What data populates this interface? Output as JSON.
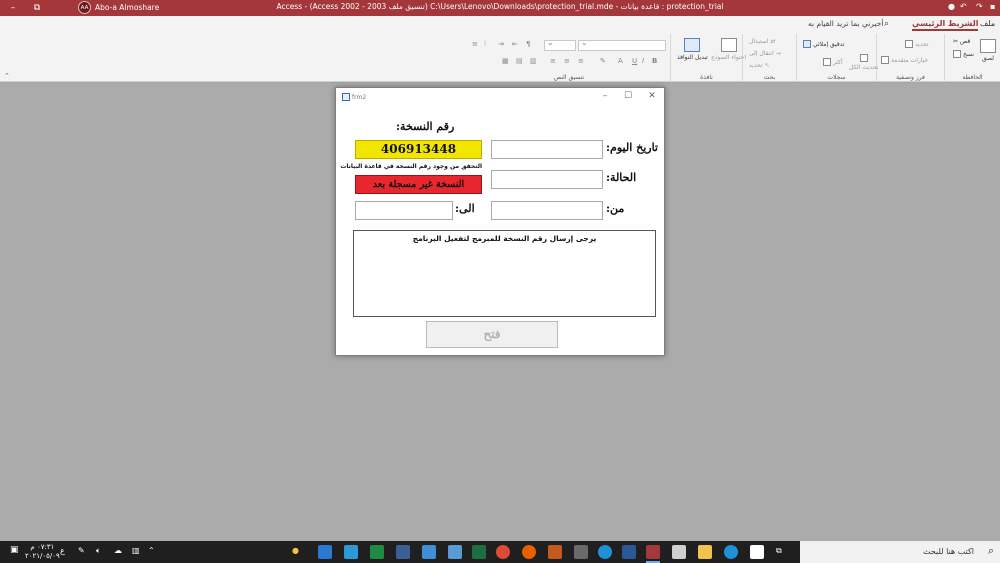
{
  "titlebar": {
    "title": "Access  -  (Access 2002 - 2003 تنسيق ملف) C:\\Users\\Lenovo\\Downloads\\protection_trial.mde - قاعدة بيانات : protection_trial",
    "user_initials": "AA",
    "user_name": "Abo-a Almoshare",
    "restore_glyph": "⧉",
    "minimize_glyph": "–"
  },
  "ribbon_tabs": {
    "file": "ملف",
    "home": "الشريط الرئيسي",
    "tell_me": "أخبرني بما تريد القيام به"
  },
  "ribbon": {
    "clipboard": {
      "paste": "لصق",
      "cut": "قص",
      "copy": "نسخ",
      "label": "الحافظة"
    },
    "sort_filter": {
      "filter": "تحديد",
      "advanced": "خيارات متقدمة",
      "label": "فرز وتصفية"
    },
    "records": {
      "spelling": "تدقيق إملائي",
      "refresh": "تحديث الكل",
      "more": "أكثر",
      "label": "سجلات"
    },
    "find": {
      "find": "استبدال",
      "goto": "انتقال إلى",
      "select": "تحديد",
      "label": "بحث"
    },
    "window": {
      "size_to_fit": "احتواء النموذج",
      "switch": "تبديل النوافذ",
      "label": "نافذة"
    },
    "text_format": {
      "bold": "B",
      "italic": "I",
      "underline": "U",
      "font_color": "A",
      "label": "تنسيق النص"
    }
  },
  "form": {
    "window_title": "frm2",
    "label_copy_no": "رقم النسخة:",
    "label_today": "تاريخ اليوم:",
    "label_status": "الحالة:",
    "label_from": "من:",
    "label_to": "الى:",
    "serial_value": "406913448",
    "check_note": "التحقق من وجود رقم النسخة في قاعدة البيانات",
    "status_text": "النسخة غير مسجلة بعد",
    "message": "يرجى إرسال رقم النسخة للمبرمج لتفعيل البرنامج",
    "open_button": "فتح",
    "colors": {
      "serial_bg": "#f2e600",
      "status_bg": "#e8262d"
    }
  },
  "taskbar": {
    "search_placeholder": "اكتب هنا للبحث",
    "time": "٠٧:٣١ م",
    "date": "٢٠٢١/٠٥/٠٩",
    "language": "ع"
  }
}
